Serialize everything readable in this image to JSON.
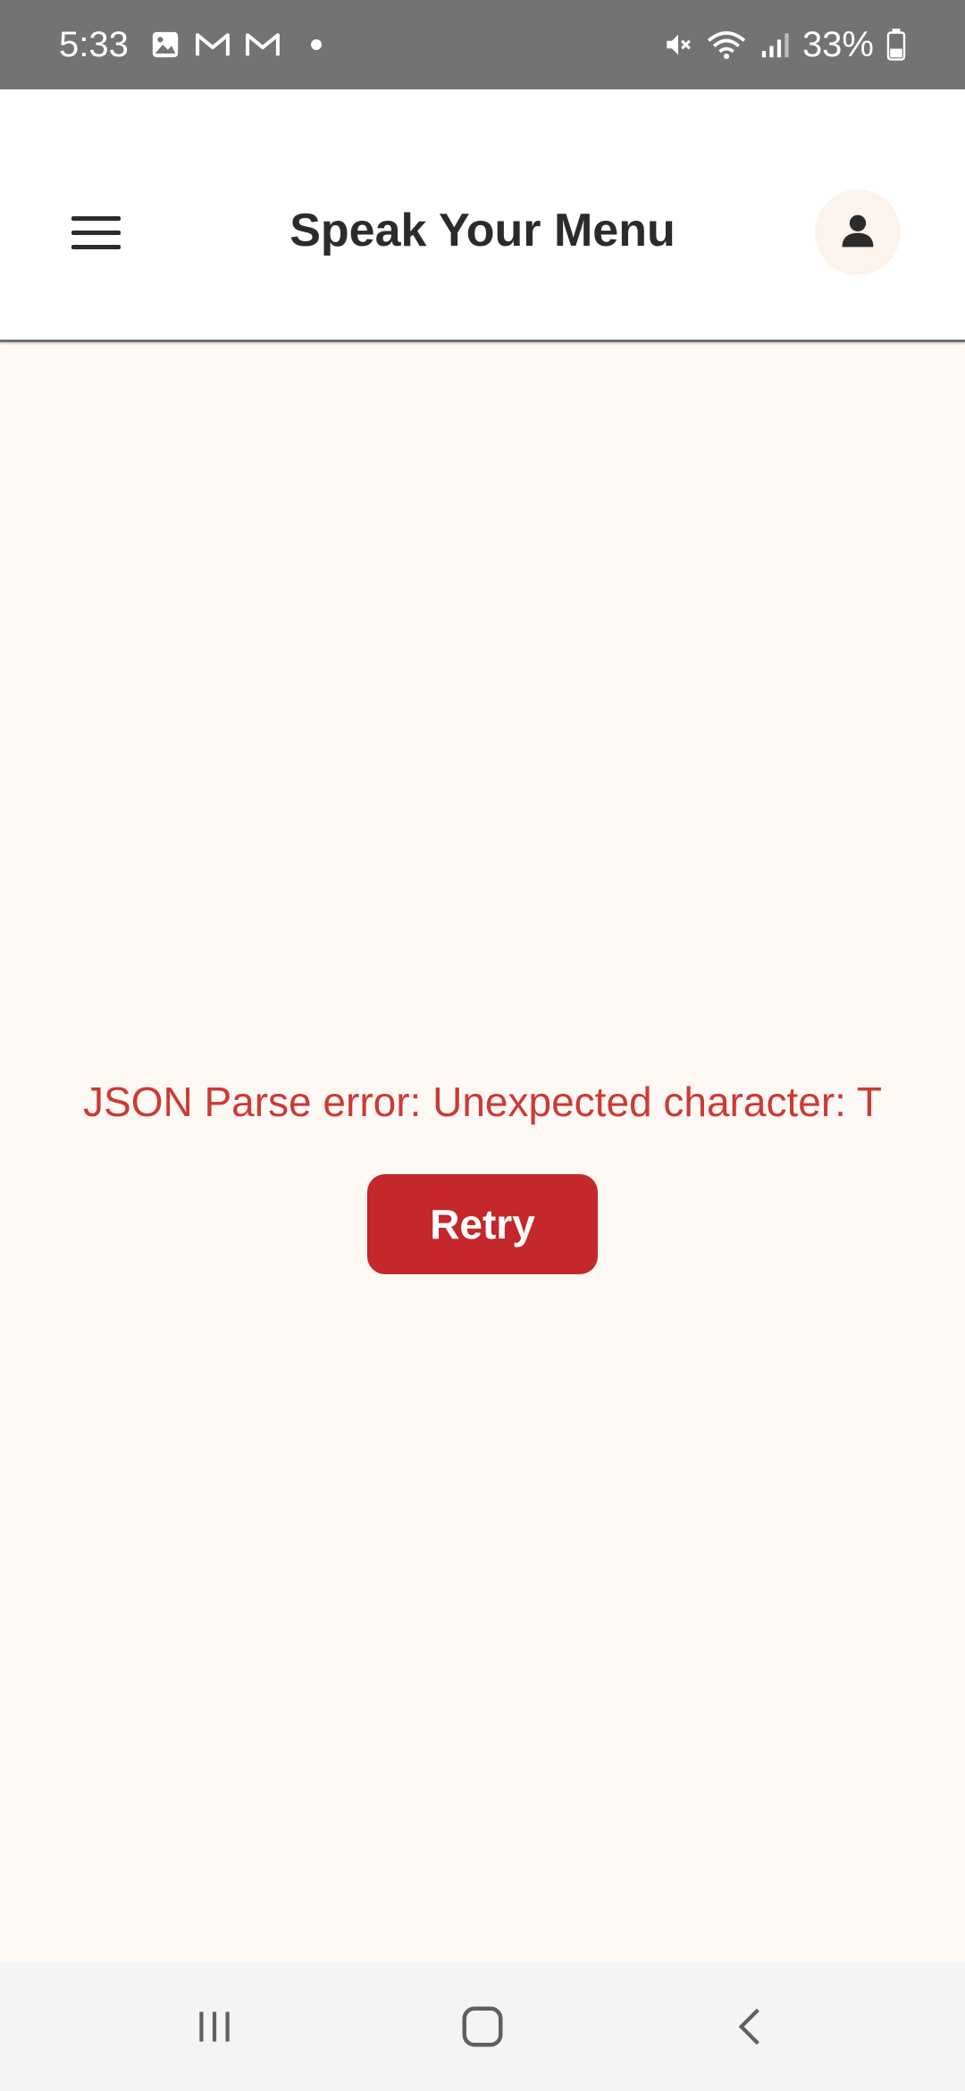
{
  "status_bar": {
    "time": "5:33",
    "battery": "33%",
    "icons_left": [
      "image-icon",
      "gmail-icon",
      "gmail-icon",
      "notification-dot-icon"
    ],
    "icons_right": [
      "mute-icon",
      "wifi-icon",
      "signal-icon",
      "battery-icon"
    ]
  },
  "header": {
    "title": "Speak Your Menu",
    "menu_icon": "hamburger-menu-icon",
    "profile_icon": "person-icon"
  },
  "main": {
    "error_message": "JSON Parse error: Unexpected character: T",
    "retry_label": "Retry"
  },
  "nav_bar": {
    "buttons": [
      "recent-apps-icon",
      "home-icon",
      "back-icon"
    ]
  },
  "colors": {
    "status_bar": "#737373",
    "background": "#fdf8f3",
    "error_text": "#cc3a36",
    "retry_button": "#c4282b",
    "title_text": "#2b2b2b"
  }
}
